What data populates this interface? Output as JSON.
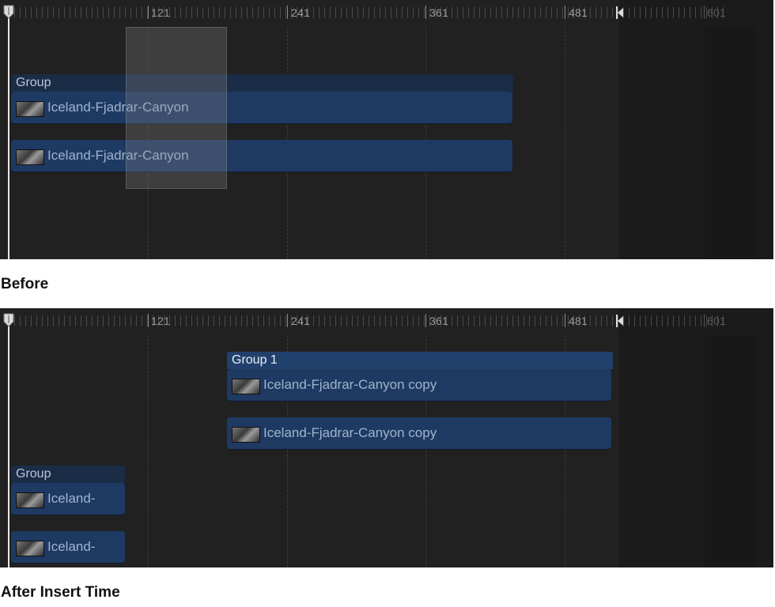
{
  "ruler_labels": [
    "121",
    "241",
    "361",
    "481",
    "601"
  ],
  "before": {
    "group_name": "Group",
    "clip1_name": "Iceland-Fjadrar-Canyon",
    "clip2_name": "Iceland-Fjadrar-Canyon",
    "caption": "Before"
  },
  "after": {
    "group1_name": "Group 1",
    "clip1_name": "Iceland-Fjadrar-Canyon copy",
    "clip2_name": "Iceland-Fjadrar-Canyon copy",
    "group_name": "Group",
    "clip3_name": "Iceland-",
    "clip4_name": "Iceland-",
    "caption": "After Insert Time"
  },
  "colors": {
    "timeline_bg": "#212121",
    "clip_fill": "#1e3a63",
    "group_header": "#1b2c47",
    "playhead": "#e8e8e8"
  },
  "icons": [
    "playhead-handle-icon",
    "play-range-end-icon",
    "clip-thumbnail-icon"
  ]
}
